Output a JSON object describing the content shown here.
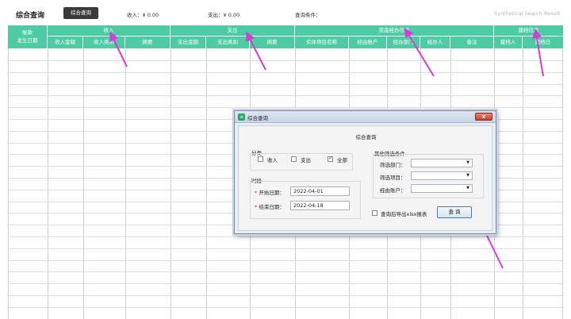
{
  "header": {
    "title": "综合查询",
    "query_button": "综合查询",
    "income": "收入：¥ 0.00",
    "expense": "支出：¥ 0.00",
    "conditions": "查询条件：",
    "subtitle": "Synthetical Search Result"
  },
  "table": {
    "first_col": [
      "账款",
      "发生日期"
    ],
    "groups": [
      "收入",
      "支出",
      "资金经办信息",
      "建档信息"
    ],
    "columns": [
      "收入金额",
      "收入类别",
      "摘要",
      "支出金额",
      "支出类别",
      "摘要",
      "实体项目名称",
      "经由账户",
      "经办部门",
      "经办人",
      "备注",
      "建档人",
      "建档日"
    ]
  },
  "dialog": {
    "title": "综合查询",
    "heading": "综合查询",
    "category_label": "分类",
    "options": [
      {
        "label": "收入",
        "checked": false
      },
      {
        "label": "支出",
        "checked": false
      },
      {
        "label": "全部",
        "checked": true
      }
    ],
    "period_label": "时段",
    "start_label": "开始日期：",
    "start_value": "2022-04-01",
    "end_label": "结束日期：",
    "end_value": "2022-04-18",
    "other_label": "其他筛选条件",
    "filter_dept": "筛选部门：",
    "filter_project": "筛选项目：",
    "via_account": "经由账户：",
    "export_label": "查询后导出xlsx报表",
    "export_checked": false,
    "query_button": "查 询",
    "close_button": "x"
  },
  "colors": {
    "header_green": "#4dcca3",
    "arrow": "#d63ad8",
    "close_red": "#c4412b"
  }
}
